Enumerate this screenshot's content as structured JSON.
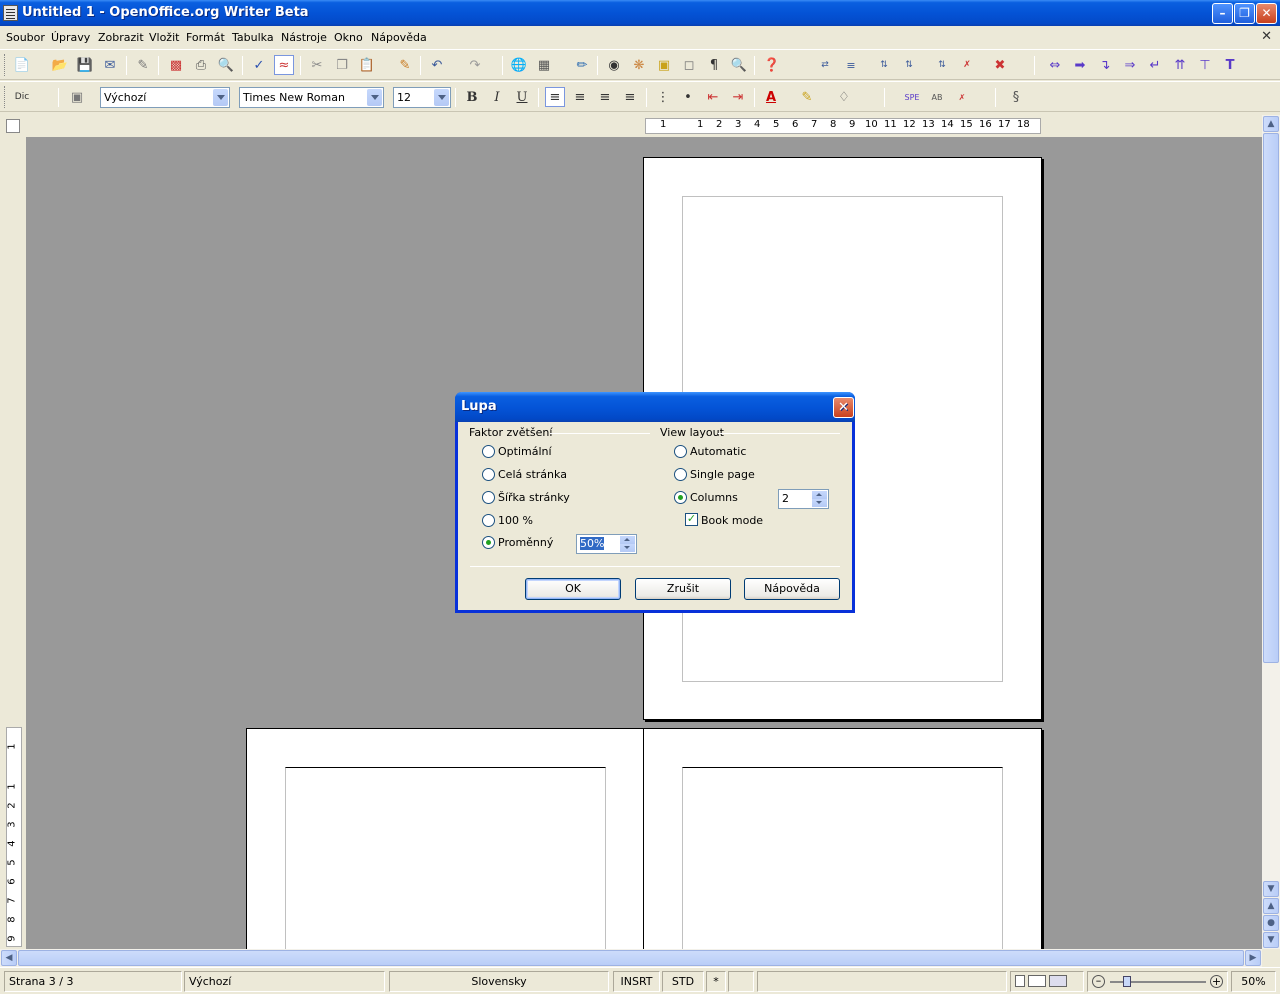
{
  "window": {
    "title": "Untitled 1 - OpenOffice.org Writer Beta",
    "icon": "document-icon"
  },
  "menu": {
    "items": [
      "Soubor",
      "Úpravy",
      "Zobrazit",
      "Vložit",
      "Formát",
      "Tabulka",
      "Nástroje",
      "Okno",
      "Nápověda"
    ]
  },
  "formatting": {
    "style": "Výchozí",
    "font": "Times New Roman",
    "size": "12"
  },
  "ruler": {
    "numbers": [
      "1",
      "1",
      "2",
      "3",
      "4",
      "5",
      "6",
      "7",
      "8",
      "9",
      "10",
      "11",
      "12",
      "13",
      "14",
      "15",
      "16",
      "17",
      "18"
    ],
    "vnumbers": [
      "1",
      "1",
      "2",
      "3",
      "4",
      "5",
      "6",
      "7",
      "8",
      "9"
    ]
  },
  "dialog": {
    "title": "Lupa",
    "zoom_group": "Faktor zvětšení",
    "layout_group": "View layout",
    "zoom_options": [
      "Optimální",
      "Celá stránka",
      "Šířka stránky",
      "100 %",
      "Proměnný"
    ],
    "zoom_selected": 4,
    "variable_value": "50%",
    "layout_options": [
      "Automatic",
      "Single page",
      "Columns"
    ],
    "layout_selected": 2,
    "columns_value": "2",
    "book_mode_label": "Book mode",
    "book_mode_checked": true,
    "ok": "OK",
    "cancel": "Zrušit",
    "help": "Nápověda"
  },
  "status": {
    "page": "Strana 3 / 3",
    "style": "Výchozí",
    "language": "Slovensky",
    "insert_mode": "INSRT",
    "selection_mode": "STD",
    "modified": "*",
    "zoom": "50%"
  },
  "colors": {
    "title_blue": "#0453d6",
    "close_red": "#c8401e",
    "doc_background": "#999999",
    "radio_green": "#21a121"
  }
}
